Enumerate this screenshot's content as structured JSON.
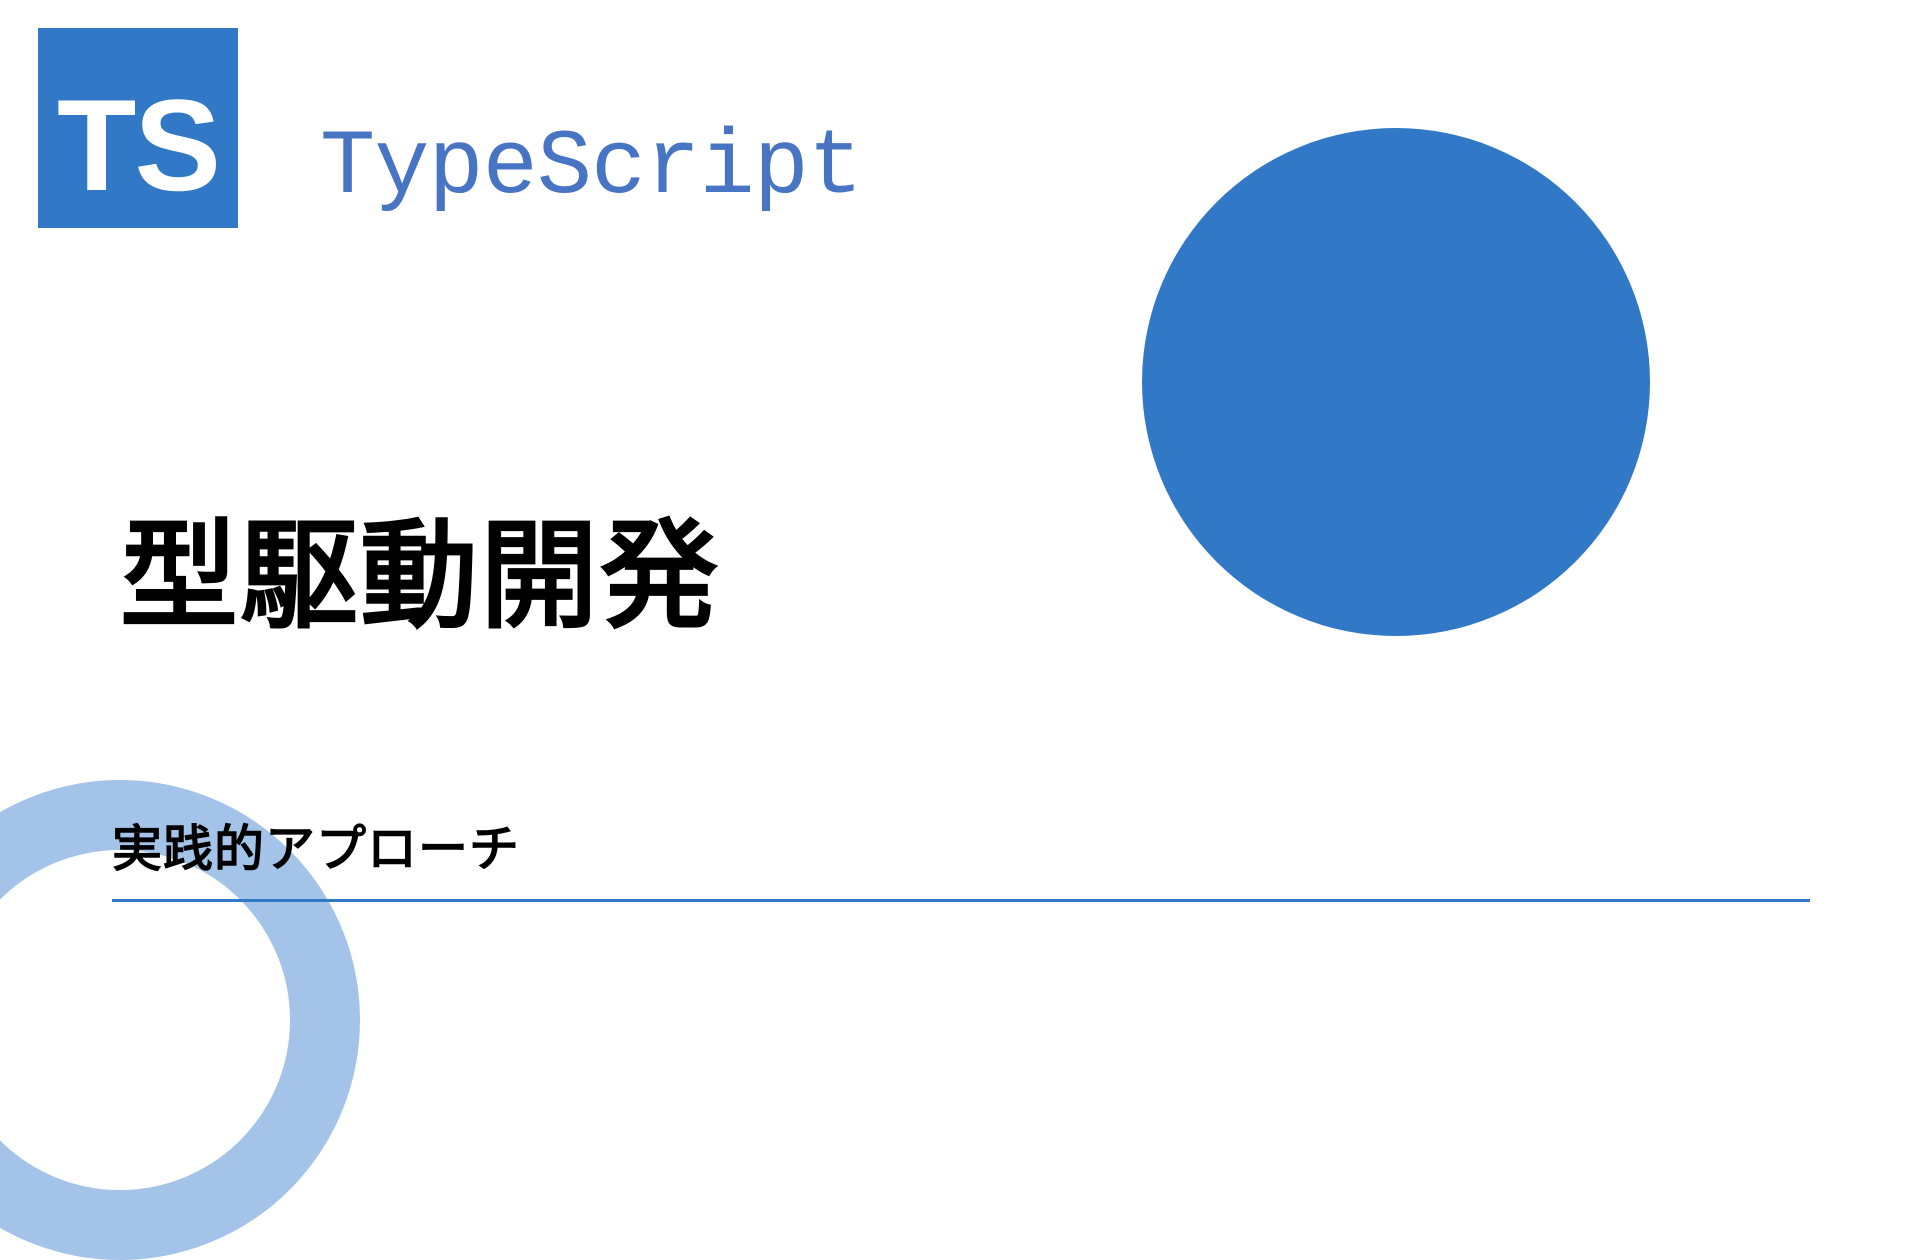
{
  "logo": {
    "text": "TS"
  },
  "brand": "TypeScript",
  "heading": "型駆動開発",
  "subtitle": "実践的アプローチ",
  "colors": {
    "primary": "#3178c6",
    "accent": "#4874c4",
    "ring": "#a3c4e8"
  }
}
